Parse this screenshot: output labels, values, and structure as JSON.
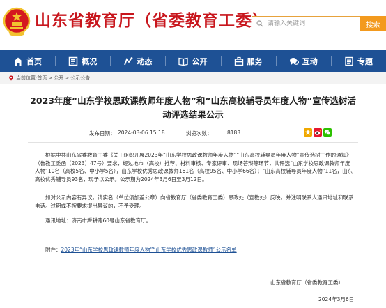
{
  "header": {
    "site_title": "山东省教育厅（省委教育工委）",
    "search_placeholder": "请输入关键词",
    "search_button": "搜索",
    "brand_color": "#c8161d",
    "accent_color": "#f39a1e"
  },
  "nav": {
    "background": "#1e5195",
    "items": [
      {
        "label": "首页",
        "icon": "home-icon"
      },
      {
        "label": "概况",
        "icon": "info-icon"
      },
      {
        "label": "动态",
        "icon": "news-icon"
      },
      {
        "label": "公开",
        "icon": "book-icon"
      },
      {
        "label": "服务",
        "icon": "service-icon"
      },
      {
        "label": "互动",
        "icon": "chat-icon"
      },
      {
        "label": "专题",
        "icon": "topic-icon"
      }
    ]
  },
  "breadcrumb": {
    "label": "当前位置:",
    "items": [
      "首页",
      "公开",
      "公示公告"
    ],
    "separator": ">"
  },
  "article": {
    "title": "2023年度“山东学校思政课教师年度人物”和“山东高校辅导员年度人物”宣传选树活动评选结果公示",
    "publish_label": "发布日期：",
    "publish_date": "2024-03-06 15:18",
    "views_label": "浏览次数：",
    "views_count": "8183",
    "para1": "根据中共山东省委教育工委《关于组织开展2023年“山东学校思政课教师年度人物”“山东高校辅导员年度人物”宣传选树工作的通知》（鲁教工委函〔2023〕47号）要求，经过地市（高校）推荐、材料审核、专家评审、现场答辩等环节，共评选“山东学校思政课教师年度人物”10名（高校5名、中小学5名），山东学校优秀思政课教师161名（高校95名、中小学66名）；“山东高校辅导员年度人物”11名，山东高校优秀辅导员93名，现予以公示。公示期为2024年3月6日至3月12日。",
    "para2": "如对公示内容有异议，请实名（单位须加盖公章）向省教育厅（省委教育工委）思政处（宣教处）反映，并注明联系人通讯地址和联系电话。过期或不按要求提出异议的，不予受理。",
    "para3": "通讯地址：济南市舜耕路60号山东省教育厅。",
    "attachment_label": "附件：",
    "attachment_link": "2023年“山东学校思政课教师年度人物”“山东学校优秀思政课教师”公示名单",
    "signature": "山东省教育厅（省委教育工委）",
    "sign_date": "2024年3月6日"
  }
}
